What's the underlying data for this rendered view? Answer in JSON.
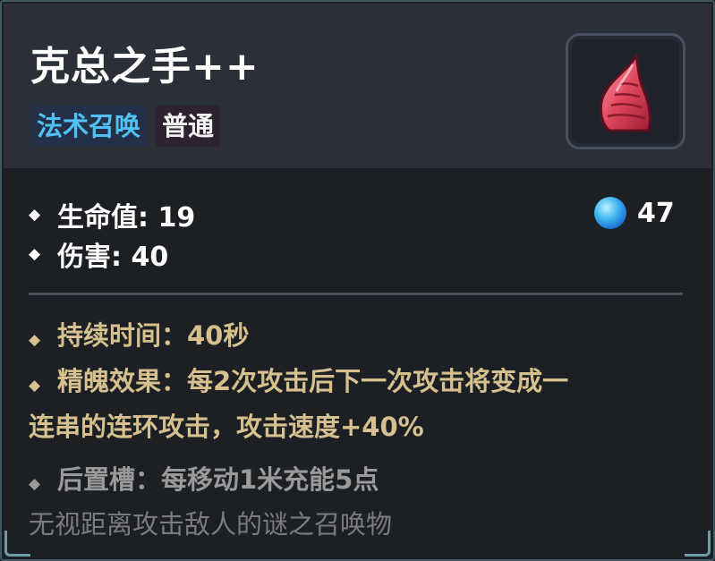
{
  "card": {
    "title": "克总之手++",
    "tags": [
      {
        "label": "法术召唤",
        "color": "#4fc1f3"
      },
      {
        "label": "普通",
        "color": "#f2f2f2"
      }
    ],
    "icon": "red-tentacle-claw-icon"
  },
  "stats": [
    {
      "label": "生命值: 19"
    },
    {
      "label": "伤害: 40"
    }
  ],
  "mana": {
    "value": "47",
    "icon": "blue-mana-orb-icon"
  },
  "effects": {
    "duration": "持续时间：40秒",
    "elite_line1": "精魄效果：每2次攻击后下一次攻击将变成一",
    "elite_line2": "连串的连环攻击，攻击速度+40%"
  },
  "passive": {
    "rear_slot": "后置槽：每移动1米充能5点",
    "flavor": "无视距离攻击敌人的谜之召唤物"
  },
  "colors": {
    "header_bg": "#2a2f38",
    "body_bg": "#1c1f24",
    "effect_gold": "#d5c08e",
    "passive_grey": "#9a9a9a",
    "summon_blue": "#4fc1f3"
  }
}
